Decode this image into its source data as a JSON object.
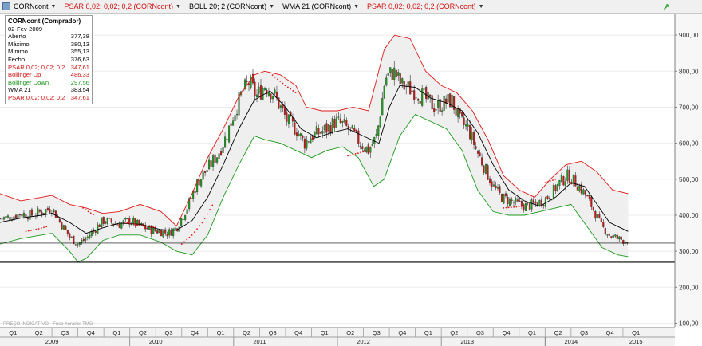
{
  "toolbar": {
    "items": [
      {
        "label": "CORNcont",
        "color": "#000000"
      },
      {
        "label": "PSAR 0,02; 0,02; 0,2 (CORNcont)",
        "color": "#d01010"
      },
      {
        "label": "BOLL 20; 2 (CORNcont)",
        "color": "#000000"
      },
      {
        "label": "WMA 21 (CORNcont)",
        "color": "#000000"
      },
      {
        "label": "PSAR 0,02; 0,02; 0,2 (CORNcont)",
        "color": "#d01010"
      }
    ]
  },
  "legend": {
    "title": "CORNcont (Comprador)",
    "date": "02-Fev-2009",
    "rows": [
      {
        "label": "Aberto",
        "value": "377,38",
        "color": "#000000"
      },
      {
        "label": "Máximo",
        "value": "380,13",
        "color": "#000000"
      },
      {
        "label": "Mínimo",
        "value": "355,13",
        "color": "#000000"
      },
      {
        "label": "Fecho",
        "value": "376,63",
        "color": "#000000"
      },
      {
        "label": "PSAR 0,02; 0,02; 0,2",
        "value": "347,61",
        "color": "#d01010"
      },
      {
        "label": "Bollinger Up",
        "value": "486,33",
        "color": "#d01010"
      },
      {
        "label": "Bollinger Down",
        "value": "297,56",
        "color": "#189018"
      },
      {
        "label": "WMA 21",
        "value": "383,54",
        "color": "#000000"
      },
      {
        "label": "PSAR 0,02; 0,02; 0,2",
        "value": "347,61",
        "color": "#d01010"
      }
    ]
  },
  "footer_note": "PREÇO INDICATIVO - Fuso horário: TMG",
  "chart_data": {
    "type": "candlestick",
    "y_ticks": [
      "100,00",
      "200,00",
      "300,00",
      "400,00",
      "500,00",
      "600,00",
      "700,00",
      "800,00",
      "900,00"
    ],
    "ylim": [
      90,
      960
    ],
    "xlim": [
      2008.75,
      2015.25
    ],
    "quarters": [
      {
        "label": "Q1",
        "t": 2008.875
      },
      {
        "label": "Q2",
        "t": 2009.125
      },
      {
        "label": "Q3",
        "t": 2009.375
      },
      {
        "label": "Q4",
        "t": 2009.625
      },
      {
        "label": "Q1",
        "t": 2009.875
      },
      {
        "label": "Q2",
        "t": 2010.125
      },
      {
        "label": "Q3",
        "t": 2010.375
      },
      {
        "label": "Q4",
        "t": 2010.625
      },
      {
        "label": "Q1",
        "t": 2010.875
      },
      {
        "label": "Q2",
        "t": 2011.125
      },
      {
        "label": "Q3",
        "t": 2011.375
      },
      {
        "label": "Q4",
        "t": 2011.625
      },
      {
        "label": "Q1",
        "t": 2011.875
      },
      {
        "label": "Q2",
        "t": 2012.125
      },
      {
        "label": "Q3",
        "t": 2012.375
      },
      {
        "label": "Q4",
        "t": 2012.625
      },
      {
        "label": "Q1",
        "t": 2012.875
      },
      {
        "label": "Q2",
        "t": 2013.125
      },
      {
        "label": "Q3",
        "t": 2013.375
      },
      {
        "label": "Q4",
        "t": 2013.625
      },
      {
        "label": "Q1",
        "t": 2013.875
      },
      {
        "label": "Q2",
        "t": 2014.125
      },
      {
        "label": "Q3",
        "t": 2014.375
      },
      {
        "label": "Q4",
        "t": 2014.625
      },
      {
        "label": "Q1",
        "t": 2014.875
      }
    ],
    "years": [
      {
        "label": "2009",
        "t": 2009.25
      },
      {
        "label": "2010",
        "t": 2010.25
      },
      {
        "label": "2011",
        "t": 2011.25
      },
      {
        "label": "2012",
        "t": 2012.25
      },
      {
        "label": "2013",
        "t": 2013.25
      },
      {
        "label": "2014",
        "t": 2014.25
      },
      {
        "label": "2015",
        "t": 2014.875
      }
    ],
    "close_path": [
      [
        2008.75,
        390
      ],
      [
        2008.85,
        395
      ],
      [
        2008.95,
        405
      ],
      [
        2009.05,
        400
      ],
      [
        2009.15,
        410
      ],
      [
        2009.25,
        420
      ],
      [
        2009.33,
        380
      ],
      [
        2009.42,
        340
      ],
      [
        2009.5,
        320
      ],
      [
        2009.58,
        335
      ],
      [
        2009.66,
        360
      ],
      [
        2009.74,
        385
      ],
      [
        2009.82,
        380
      ],
      [
        2009.9,
        375
      ],
      [
        2010.0,
        385
      ],
      [
        2010.1,
        370
      ],
      [
        2010.2,
        360
      ],
      [
        2010.3,
        355
      ],
      [
        2010.37,
        350
      ],
      [
        2010.45,
        365
      ],
      [
        2010.55,
        420
      ],
      [
        2010.65,
        490
      ],
      [
        2010.75,
        530
      ],
      [
        2010.85,
        570
      ],
      [
        2010.93,
        620
      ],
      [
        2011.0,
        680
      ],
      [
        2011.08,
        740
      ],
      [
        2011.15,
        770
      ],
      [
        2011.22,
        730
      ],
      [
        2011.3,
        760
      ],
      [
        2011.38,
        740
      ],
      [
        2011.45,
        700
      ],
      [
        2011.52,
        660
      ],
      [
        2011.6,
        640
      ],
      [
        2011.68,
        600
      ],
      [
        2011.75,
        620
      ],
      [
        2011.83,
        630
      ],
      [
        2011.9,
        640
      ],
      [
        2011.98,
        660
      ],
      [
        2012.06,
        650
      ],
      [
        2012.14,
        630
      ],
      [
        2012.22,
        600
      ],
      [
        2012.3,
        580
      ],
      [
        2012.38,
        620
      ],
      [
        2012.46,
        780
      ],
      [
        2012.54,
        800
      ],
      [
        2012.62,
        760
      ],
      [
        2012.7,
        750
      ],
      [
        2012.78,
        740
      ],
      [
        2012.86,
        720
      ],
      [
        2012.94,
        700
      ],
      [
        2013.02,
        710
      ],
      [
        2013.1,
        720
      ],
      [
        2013.18,
        660
      ],
      [
        2013.26,
        640
      ],
      [
        2013.34,
        580
      ],
      [
        2013.42,
        530
      ],
      [
        2013.5,
        480
      ],
      [
        2013.58,
        450
      ],
      [
        2013.66,
        440
      ],
      [
        2013.74,
        430
      ],
      [
        2013.82,
        425
      ],
      [
        2013.9,
        430
      ],
      [
        2013.98,
        440
      ],
      [
        2014.06,
        460
      ],
      [
        2014.14,
        490
      ],
      [
        2014.22,
        510
      ],
      [
        2014.3,
        490
      ],
      [
        2014.38,
        460
      ],
      [
        2014.46,
        420
      ],
      [
        2014.54,
        370
      ],
      [
        2014.62,
        345
      ],
      [
        2014.7,
        335
      ],
      [
        2014.76,
        330
      ],
      [
        2014.8,
        330
      ]
    ],
    "wma21": [
      [
        2008.75,
        380
      ],
      [
        2008.95,
        392
      ],
      [
        2009.15,
        400
      ],
      [
        2009.25,
        405
      ],
      [
        2009.42,
        380
      ],
      [
        2009.58,
        350
      ],
      [
        2009.74,
        365
      ],
      [
        2009.9,
        378
      ],
      [
        2010.1,
        375
      ],
      [
        2010.3,
        360
      ],
      [
        2010.45,
        358
      ],
      [
        2010.6,
        385
      ],
      [
        2010.75,
        450
      ],
      [
        2010.9,
        540
      ],
      [
        2011.05,
        640
      ],
      [
        2011.2,
        720
      ],
      [
        2011.35,
        745
      ],
      [
        2011.5,
        700
      ],
      [
        2011.65,
        640
      ],
      [
        2011.8,
        615
      ],
      [
        2011.95,
        630
      ],
      [
        2012.1,
        640
      ],
      [
        2012.25,
        620
      ],
      [
        2012.4,
        600
      ],
      [
        2012.5,
        700
      ],
      [
        2012.6,
        760
      ],
      [
        2012.75,
        755
      ],
      [
        2012.9,
        725
      ],
      [
        2013.05,
        712
      ],
      [
        2013.2,
        690
      ],
      [
        2013.35,
        630
      ],
      [
        2013.5,
        540
      ],
      [
        2013.65,
        470
      ],
      [
        2013.8,
        440
      ],
      [
        2013.95,
        425
      ],
      [
        2014.1,
        450
      ],
      [
        2014.25,
        490
      ],
      [
        2014.38,
        480
      ],
      [
        2014.5,
        430
      ],
      [
        2014.62,
        380
      ],
      [
        2014.8,
        355
      ]
    ],
    "bollinger_up": [
      [
        2008.75,
        460
      ],
      [
        2008.95,
        440
      ],
      [
        2009.15,
        450
      ],
      [
        2009.25,
        455
      ],
      [
        2009.42,
        430
      ],
      [
        2009.58,
        420
      ],
      [
        2009.74,
        405
      ],
      [
        2009.9,
        410
      ],
      [
        2010.1,
        430
      ],
      [
        2010.3,
        410
      ],
      [
        2010.45,
        370
      ],
      [
        2010.6,
        460
      ],
      [
        2010.75,
        560
      ],
      [
        2010.9,
        640
      ],
      [
        2011.05,
        730
      ],
      [
        2011.2,
        790
      ],
      [
        2011.3,
        800
      ],
      [
        2011.45,
        790
      ],
      [
        2011.6,
        760
      ],
      [
        2011.7,
        700
      ],
      [
        2011.85,
        690
      ],
      [
        2012.0,
        690
      ],
      [
        2012.15,
        700
      ],
      [
        2012.3,
        690
      ],
      [
        2012.45,
        860
      ],
      [
        2012.55,
        900
      ],
      [
        2012.7,
        890
      ],
      [
        2012.85,
        800
      ],
      [
        2013.0,
        760
      ],
      [
        2013.15,
        740
      ],
      [
        2013.3,
        690
      ],
      [
        2013.45,
        610
      ],
      [
        2013.6,
        510
      ],
      [
        2013.75,
        470
      ],
      [
        2013.9,
        450
      ],
      [
        2014.05,
        500
      ],
      [
        2014.2,
        540
      ],
      [
        2014.35,
        550
      ],
      [
        2014.5,
        520
      ],
      [
        2014.65,
        470
      ],
      [
        2014.8,
        460
      ]
    ],
    "bollinger_down": [
      [
        2008.75,
        320
      ],
      [
        2008.95,
        335
      ],
      [
        2009.15,
        345
      ],
      [
        2009.25,
        350
      ],
      [
        2009.42,
        300
      ],
      [
        2009.5,
        270
      ],
      [
        2009.58,
        280
      ],
      [
        2009.74,
        330
      ],
      [
        2009.9,
        345
      ],
      [
        2010.1,
        345
      ],
      [
        2010.3,
        325
      ],
      [
        2010.45,
        300
      ],
      [
        2010.6,
        290
      ],
      [
        2010.75,
        345
      ],
      [
        2010.9,
        450
      ],
      [
        2011.05,
        540
      ],
      [
        2011.2,
        620
      ],
      [
        2011.3,
        610
      ],
      [
        2011.45,
        600
      ],
      [
        2011.6,
        580
      ],
      [
        2011.75,
        560
      ],
      [
        2011.9,
        580
      ],
      [
        2012.05,
        590
      ],
      [
        2012.2,
        560
      ],
      [
        2012.35,
        480
      ],
      [
        2012.45,
        500
      ],
      [
        2012.6,
        620
      ],
      [
        2012.75,
        680
      ],
      [
        2012.9,
        660
      ],
      [
        2013.05,
        640
      ],
      [
        2013.2,
        580
      ],
      [
        2013.35,
        470
      ],
      [
        2013.5,
        410
      ],
      [
        2013.65,
        400
      ],
      [
        2013.8,
        400
      ],
      [
        2013.95,
        410
      ],
      [
        2014.1,
        420
      ],
      [
        2014.25,
        430
      ],
      [
        2014.4,
        370
      ],
      [
        2014.55,
        310
      ],
      [
        2014.7,
        290
      ],
      [
        2014.8,
        285
      ]
    ],
    "psar_segments": [
      [
        [
          2009.0,
          355
        ],
        [
          2009.12,
          362
        ],
        [
          2009.22,
          370
        ]
      ],
      [
        [
          2009.55,
          420
        ],
        [
          2009.6,
          410
        ],
        [
          2009.66,
          400
        ]
      ],
      [
        [
          2009.95,
          380
        ],
        [
          2010.1,
          372
        ],
        [
          2010.25,
          366
        ]
      ],
      [
        [
          2010.5,
          320
        ],
        [
          2010.6,
          345
        ],
        [
          2010.7,
          380
        ],
        [
          2010.8,
          430
        ]
      ],
      [
        [
          2011.35,
          795
        ],
        [
          2011.5,
          760
        ],
        [
          2011.6,
          740
        ]
      ],
      [
        [
          2012.1,
          565
        ],
        [
          2012.3,
          580
        ]
      ],
      [
        [
          2013.6,
          420
        ],
        [
          2013.8,
          425
        ]
      ],
      [
        [
          2014.0,
          490
        ],
        [
          2014.1,
          500
        ]
      ]
    ],
    "price_markers": [
      {
        "label": "322,50",
        "value": 322.5
      },
      {
        "label": "269,50",
        "value": 269.5
      }
    ],
    "colors": {
      "up_candle": "#1c9a1c",
      "down_candle": "#c81818",
      "wma": "#000000",
      "bollinger_up": "#e01818",
      "bollinger_down": "#1c9a1c",
      "band_fill": "#efefef",
      "psar": "#e01818"
    }
  }
}
